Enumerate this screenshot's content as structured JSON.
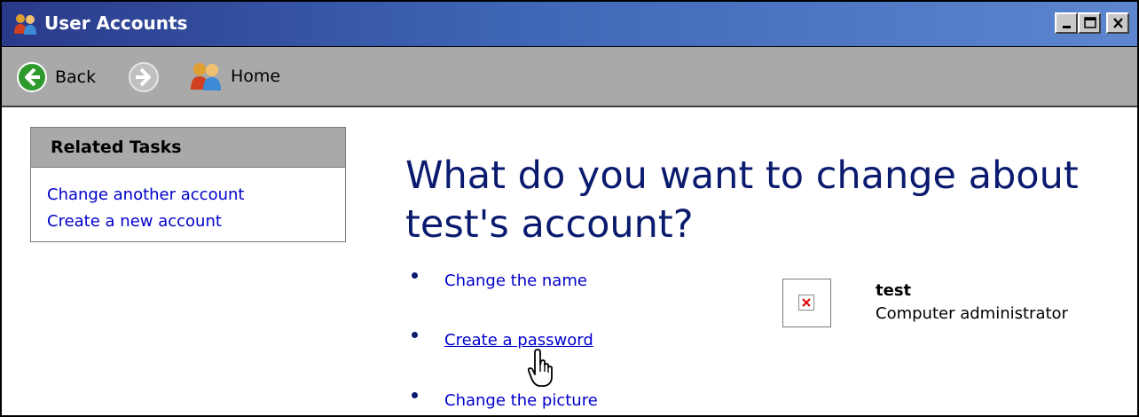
{
  "window": {
    "title": "User Accounts",
    "controls": {
      "minimize": "minimize-icon",
      "maximize": "maximize-icon",
      "close": "close-icon"
    }
  },
  "toolbar": {
    "back_label": "Back",
    "home_label": "Home"
  },
  "sidebar": {
    "heading": "Related Tasks",
    "links": [
      "Change another account",
      "Create a new account"
    ]
  },
  "main": {
    "headline_line1": "What do you want to change about",
    "headline_line2": "test's account?",
    "options": [
      "Change the name",
      "Create a password",
      "Change the picture"
    ],
    "hovered_option": "Create a password"
  },
  "account": {
    "name": "test",
    "role": "Computer administrator"
  },
  "colors": {
    "title_bar": "#3f66b6",
    "toolbar_bg": "#a9a9a9",
    "link": "#0000cc",
    "headline": "#0a1a6e",
    "back_arrow": "#2e9a2e"
  }
}
